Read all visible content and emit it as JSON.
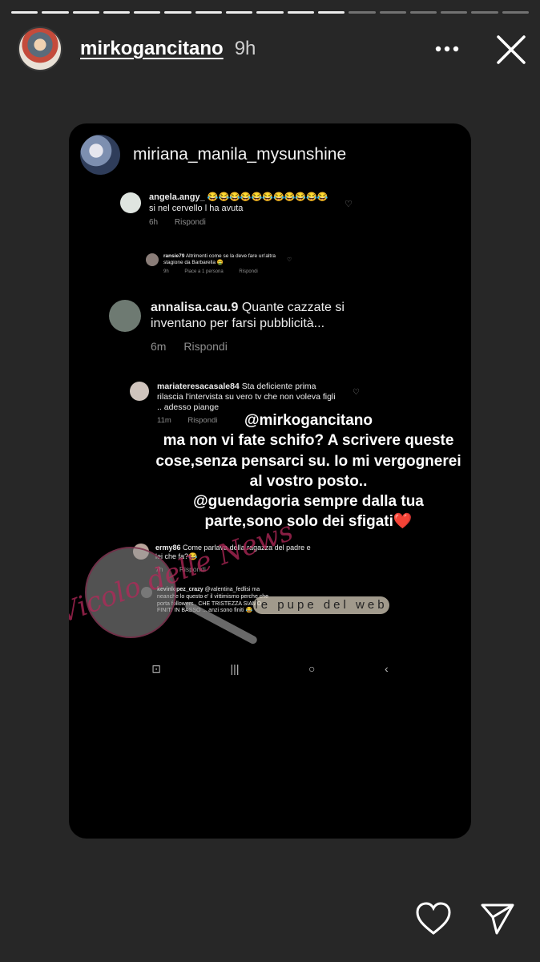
{
  "story": {
    "progress": {
      "total": 17,
      "current": 11
    },
    "user": {
      "username": "mirkogancitano",
      "time": "9h"
    }
  },
  "card": {
    "username": "miriana_manila_mysunshine",
    "comments": [
      {
        "user": "angela.angy_",
        "text": "😂😂😂😂😂😂😂😂😂😂😂 si nel cervello l ha avuta",
        "time": "6h",
        "reply": "Rispondi"
      },
      {
        "user": "ransie79",
        "text": "Altrimenti come se la deve fare un'altra stagione da Barbarella 🤮",
        "time": "9h",
        "likes": "Piace a 1 persona",
        "reply": "Rispondi"
      },
      {
        "user": "annalisa.cau.9",
        "text": "Quante cazzate si inventano per farsi pubblicità...",
        "time": "6m",
        "reply": "Rispondi"
      },
      {
        "user": "mariateresacasale84",
        "text": "Sta deficiente prima rilascia l'intervista su vero tv che non voleva figli .. adesso piange",
        "time": "11m",
        "reply": "Rispondi"
      },
      {
        "user": "ermy86",
        "text": "Come parlava della ragazza del padre e lei che fa?😂",
        "time": "7h",
        "reply": "Rispondi"
      },
      {
        "user": "kevinlopez_crazy",
        "text": "@valentina_fedlisi ma neanche lo questo e' il vittimismo perche che porta followers . CHE TRISTEZZA SIAMO FINITI IN BASSO ... anzi sono finiti 😂"
      }
    ],
    "overlay_text": "@mirkogancitano\nma non vi fate schifo? A scrivere queste cose,senza pensarci su. Io mi vergognerei al vostro posto..\n@guendagoria sempre dalla tua parte,sono solo dei sfigati❤️",
    "watermark": {
      "script": "Vicolo delle News",
      "banner": "le pupe del web"
    },
    "navbar": [
      "⊡",
      "|||",
      "○",
      "‹"
    ]
  },
  "icons": {
    "more": "more-dots-icon",
    "close": "close-icon",
    "like": "heart-icon",
    "share": "send-icon"
  }
}
